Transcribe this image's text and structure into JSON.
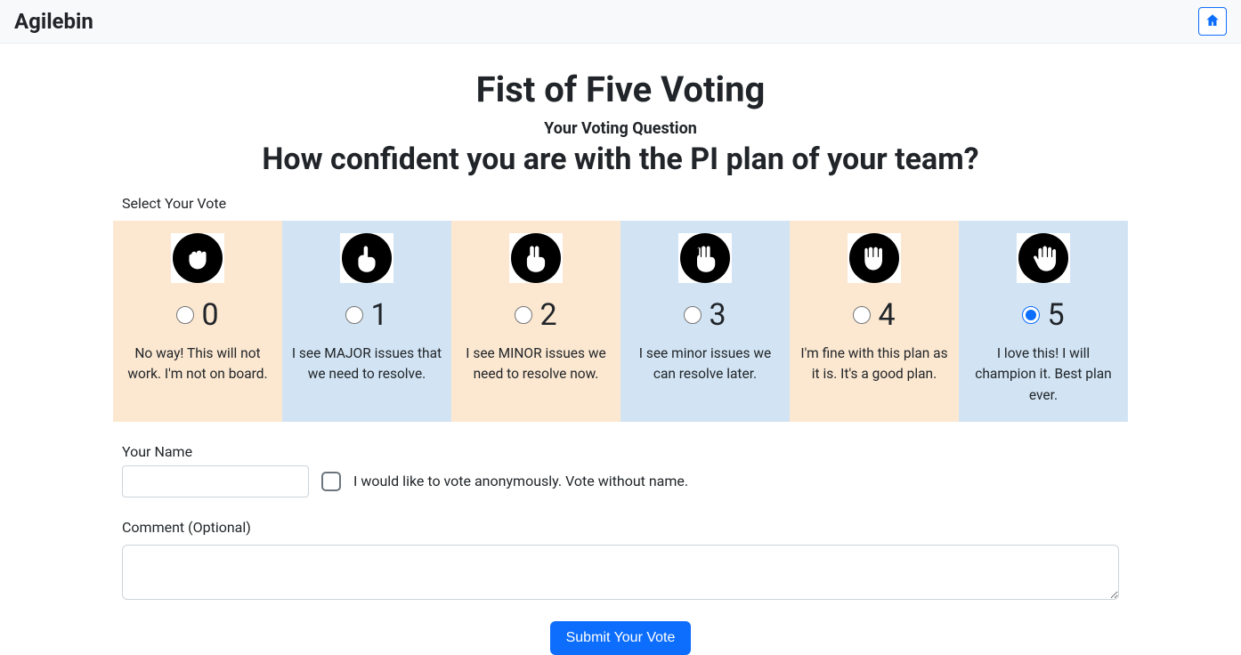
{
  "header": {
    "brand": "Agilebin",
    "home_icon": "home-icon"
  },
  "page_title": "Fist of Five Voting",
  "subtitle": "Your Voting Question",
  "question": "How confident you are with the PI plan of your team?",
  "select_label": "Select Your Vote",
  "votes": [
    {
      "num": "0",
      "desc": "No way! This will not work. I'm not on board.",
      "color": "peach",
      "hand": "fist",
      "selected": false
    },
    {
      "num": "1",
      "desc": "I see MAJOR issues that we need to resolve.",
      "color": "blue",
      "hand": "one",
      "selected": false
    },
    {
      "num": "2",
      "desc": "I see MINOR issues we need to resolve now.",
      "color": "peach",
      "hand": "two",
      "selected": false
    },
    {
      "num": "3",
      "desc": "I see minor issues we can resolve later.",
      "color": "blue",
      "hand": "three",
      "selected": false
    },
    {
      "num": "4",
      "desc": "I'm fine with this plan as it is. It's a good plan.",
      "color": "peach",
      "hand": "four",
      "selected": false
    },
    {
      "num": "5",
      "desc": "I love this! I will champion it. Best plan ever.",
      "color": "blue",
      "hand": "five",
      "selected": true
    }
  ],
  "form": {
    "name_label": "Your Name",
    "name_value": "",
    "anon_label": "I would like to vote anonymously. Vote without name.",
    "anon_checked": false,
    "comment_label": "Comment (Optional)",
    "comment_value": "",
    "submit_label": "Submit Your Vote"
  }
}
